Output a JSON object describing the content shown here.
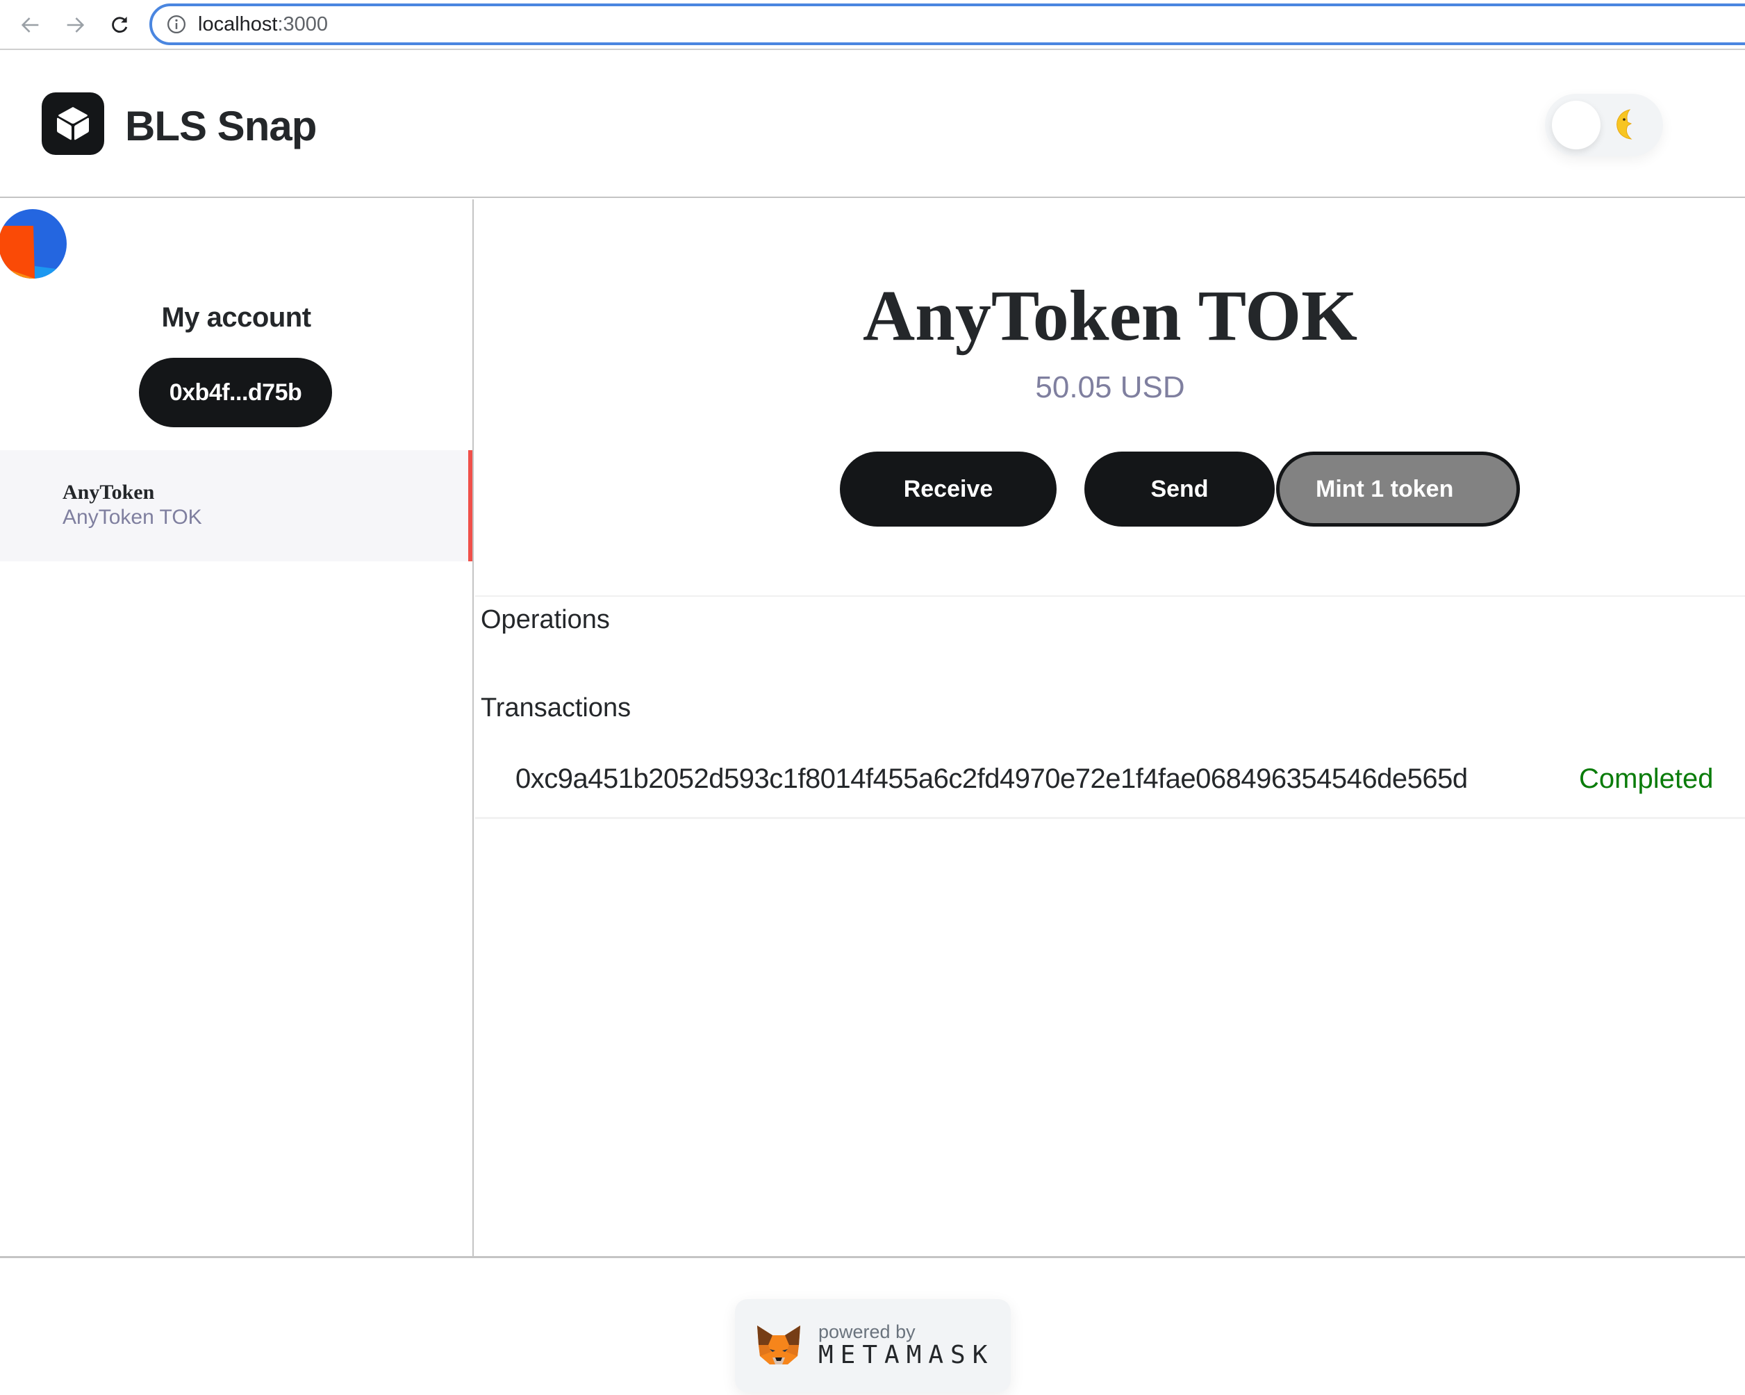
{
  "browser": {
    "url_host": "localhost",
    "url_port": ":3000",
    "icons": [
      "back-arrow-icon",
      "forward-arrow-icon",
      "reload-icon",
      "info-icon"
    ]
  },
  "header": {
    "app_title": "BLS Snap",
    "logo_icon": "cube-icon",
    "theme_toggle_icon": "crescent-moon-icon",
    "theme_toggle_state": "light"
  },
  "sidebar": {
    "account_title": "My account",
    "address_short": "0xb4f...d75b",
    "tokens": [
      {
        "name": "AnyToken",
        "subtitle": "AnyToken TOK",
        "selected": true
      }
    ]
  },
  "main": {
    "token_title": "AnyToken TOK",
    "balance_usd": "50.05 USD",
    "buttons": {
      "receive": "Receive",
      "send": "Send",
      "mint": "Mint 1 token"
    },
    "sections": {
      "operations": "Operations",
      "transactions": "Transactions"
    },
    "transactions": [
      {
        "hash": "0xc9a451b2052d593c1f8014f455a6c2fd4970e72e1f4fae068496354546de565d",
        "status": "Completed"
      }
    ]
  },
  "footer": {
    "powered_by": "powered by",
    "brand": "METAMASK"
  },
  "colors": {
    "primary_dark": "#141618",
    "text": "#24272a",
    "muted": "#7f7f9f",
    "selected_accent": "#f0504a",
    "status_completed": "#0a7c0a",
    "mint_button": "#828282",
    "url_focus": "#4a86e0"
  }
}
